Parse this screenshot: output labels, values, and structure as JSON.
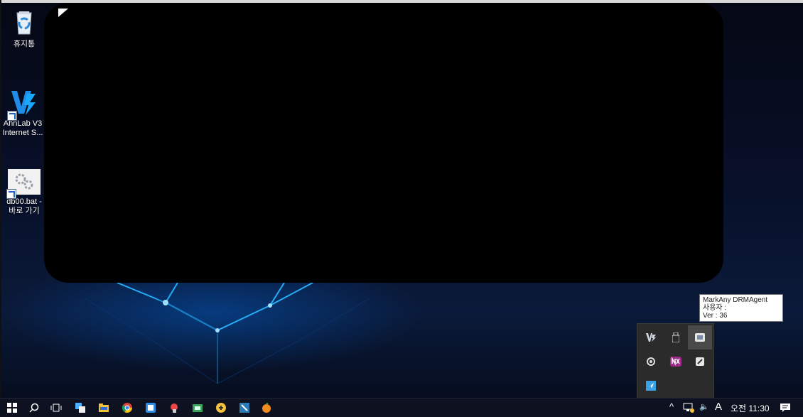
{
  "desktop": {
    "icons": [
      {
        "name": "recycle-bin-icon",
        "label": "휴지통"
      },
      {
        "name": "ahnlab-v3-icon",
        "label_line1": "AhnLab V3",
        "label_line2": "Internet S..."
      },
      {
        "name": "batch-shortcut-icon",
        "label_line1": "db00.bat -",
        "label_line2": "바로 가기"
      }
    ]
  },
  "tooltip": {
    "line1": "MarkAny DRMAgent",
    "line2": "사용자 :",
    "line3": "Ver : 36"
  },
  "tray_popup": {
    "icons": [
      "v3-tray-icon",
      "usb-icon",
      "markany-drm-icon",
      "swirl-icon",
      "nx-icon",
      "drm-file-icon",
      "send-arrow-icon"
    ]
  },
  "taskbar": {
    "left_icons": [
      "windows-start-icon",
      "search-icon",
      "task-view-icon",
      "app-icon-1",
      "file-explorer-icon",
      "chrome-icon",
      "app-icon-2",
      "app-icon-3",
      "app-icon-4",
      "app-icon-5",
      "app-icon-6",
      "app-icon-7"
    ],
    "tray": {
      "chevron": "^",
      "speaker_glyph": "🔈",
      "ime_label": "A",
      "clock": "오전 11:30"
    }
  },
  "colors": {
    "accent": "#1fa8ff",
    "taskbar_bg": "#0e1220",
    "tray_bg": "#2b2b2b"
  }
}
